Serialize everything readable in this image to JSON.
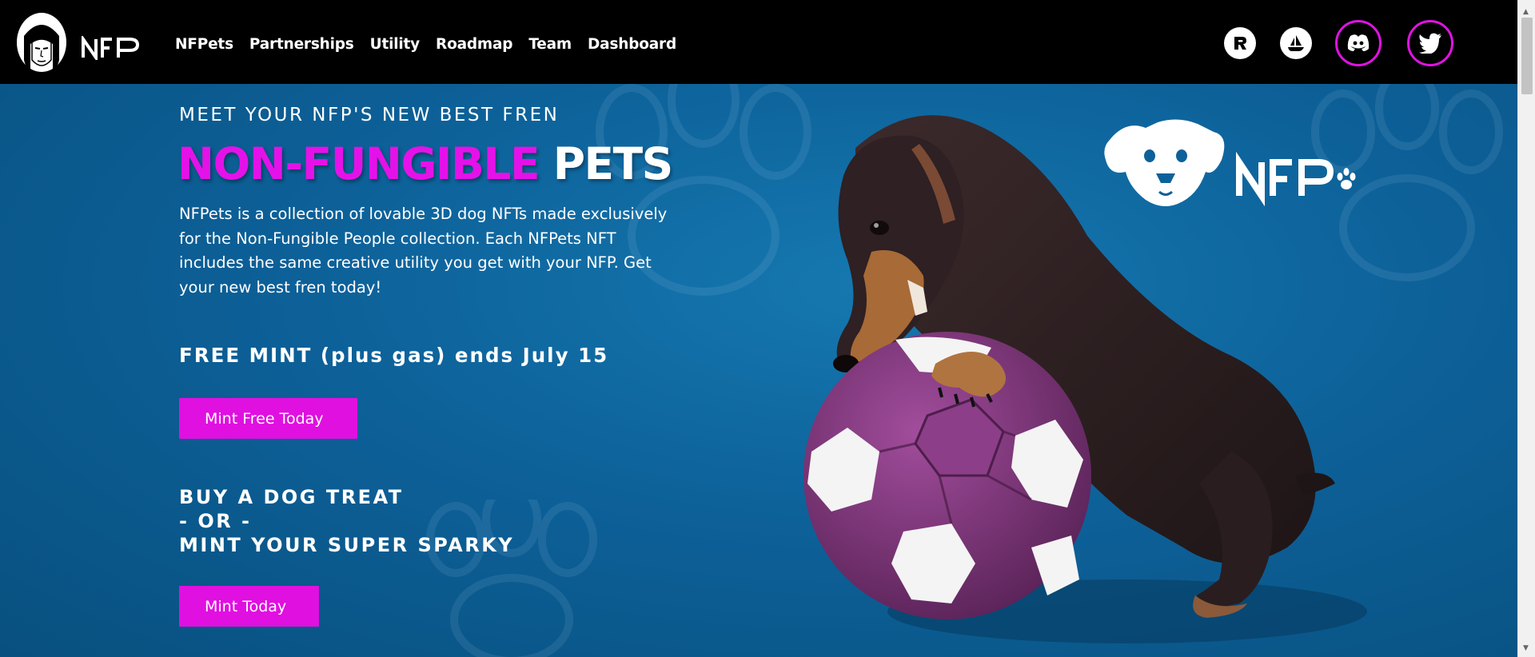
{
  "header": {
    "logo_text": "NFP",
    "nav": [
      "NFPets",
      "Partnerships",
      "Utility",
      "Roadmap",
      "Team",
      "Dashboard"
    ],
    "socials": [
      "rarible-icon",
      "opensea-icon",
      "discord-icon",
      "twitter-icon"
    ]
  },
  "hero": {
    "eyebrow": "MEET YOUR NFP'S NEW BEST FREN",
    "headline_magenta": "NON-FUNGIBLE",
    "headline_white": "PETS",
    "description": "NFPets is a collection of lovable 3D dog NFTs made exclusively for the Non-Fungible People collection. Each NFPets NFT includes the same creative utility you get with your NFP. Get your new best fren today!",
    "free_mint": "FREE MINT (plus gas) ends July 15",
    "free_button": "Mint Free Today",
    "buy_lines": [
      "BUY A DOG TREAT",
      "- OR -",
      "MINT YOUR SUPER SPARKY"
    ],
    "mint_button": "Mint Today",
    "brand_text": "NFP"
  },
  "colors": {
    "accent": "#e412e8",
    "header_bg": "#000000",
    "hero_bg": "#0d6199",
    "ball": "#8a3b86"
  }
}
